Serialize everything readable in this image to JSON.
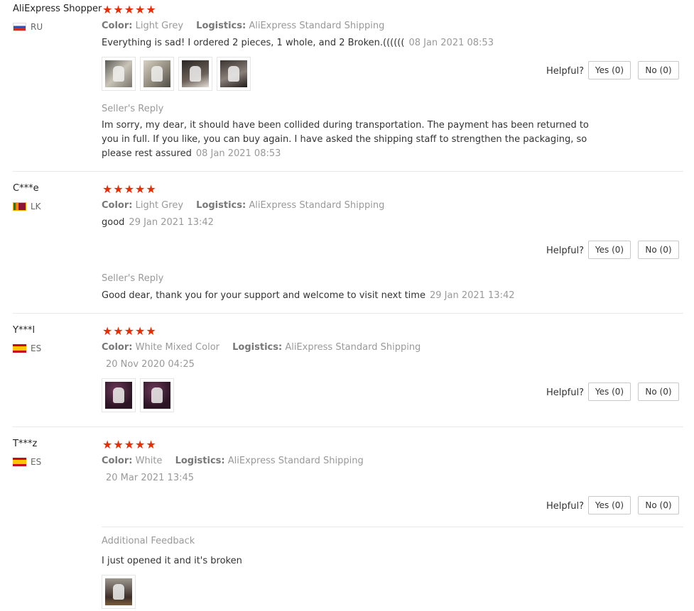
{
  "helpful_label": "Helpful?",
  "reviews": [
    {
      "user": "AliExpress Shopper",
      "country": "RU",
      "stars": "★★★★★",
      "color_label": "Color:",
      "color_value": "Light Grey",
      "logistics_label": "Logistics:",
      "logistics_value": "AliExpress Standard Shipping",
      "text": "Everything is sad! I ordered 2 pieces, 1 whole, and 2 Broken.((((((",
      "date": "08 Jan 2021 08:53",
      "yes": "Yes (0)",
      "no": "No (0)",
      "reply_title": "Seller's Reply",
      "reply_text": "Im sorry, my dear, it should have been collided during transportation. The payment has been returned to you in full. If you like, you can buy again. I have asked the shipping staff to strengthen the packaging, so please rest assured",
      "reply_date": "08 Jan 2021 08:53"
    },
    {
      "user": "C***e",
      "country": "LK",
      "stars": "★★★★★",
      "color_label": "Color:",
      "color_value": "Light Grey",
      "logistics_label": "Logistics:",
      "logistics_value": "AliExpress Standard Shipping",
      "text": "good",
      "date": "29 Jan 2021 13:42",
      "yes": "Yes (0)",
      "no": "No (0)",
      "reply_title": "Seller's Reply",
      "reply_text": "Good dear, thank you for your support and welcome to visit next time",
      "reply_date": "29 Jan 2021 13:42"
    },
    {
      "user": "Y***l",
      "country": "ES",
      "stars": "★★★★★",
      "color_label": "Color:",
      "color_value": "White Mixed Color",
      "logistics_label": "Logistics:",
      "logistics_value": "AliExpress Standard Shipping",
      "date": "20 Nov 2020 04:25",
      "yes": "Yes (0)",
      "no": "No (0)"
    },
    {
      "user": "T***z",
      "country": "ES",
      "stars": "★★★★★",
      "color_label": "Color:",
      "color_value": "White",
      "logistics_label": "Logistics:",
      "logistics_value": "AliExpress Standard Shipping",
      "date": "20 Mar 2021 13:45",
      "yes": "Yes (0)",
      "no": "No (0)",
      "additional_title": "Additional Feedback",
      "additional_text": "I just opened it and it's broken"
    }
  ]
}
